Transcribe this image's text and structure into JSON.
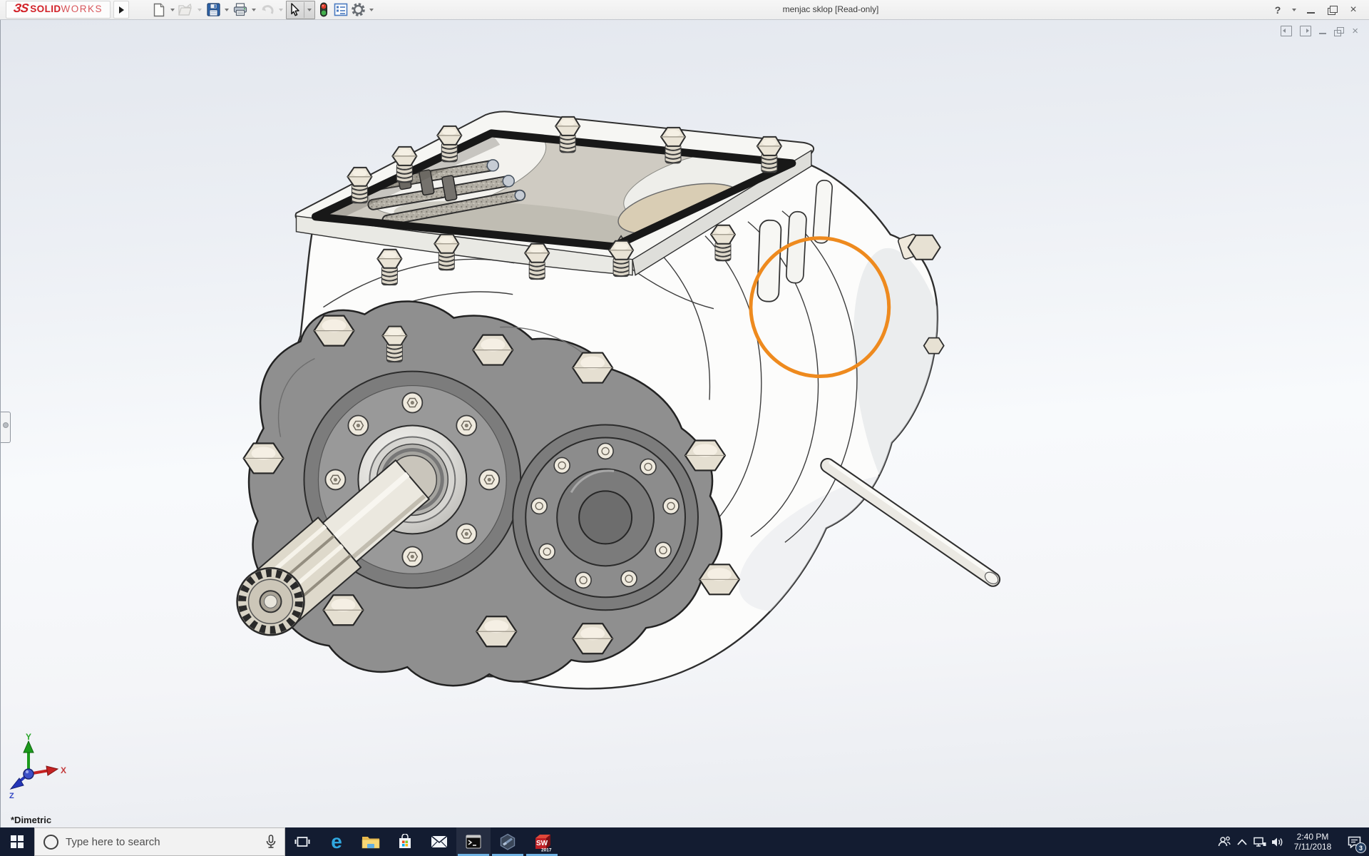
{
  "window": {
    "title": "menjac sklop [Read-only]",
    "help_label": "?"
  },
  "brand": {
    "logo_glyph": "ЗS",
    "logo_bold": "SOLID",
    "logo_light": "WORKS",
    "logo_color": "#d22128"
  },
  "toolbar": {
    "buttons": [
      {
        "name": "new-document",
        "enabled": true,
        "dropdown": true,
        "selected": false
      },
      {
        "name": "open-document",
        "enabled": false,
        "dropdown": true,
        "selected": false
      },
      {
        "name": "save",
        "enabled": true,
        "dropdown": true,
        "selected": false
      },
      {
        "name": "print",
        "enabled": true,
        "dropdown": true,
        "selected": false
      },
      {
        "name": "undo",
        "enabled": false,
        "dropdown": true,
        "selected": false
      },
      {
        "name": "select",
        "enabled": true,
        "dropdown": true,
        "selected": true
      },
      {
        "name": "rebuild-traffic-light",
        "enabled": true,
        "dropdown": false,
        "selected": false
      },
      {
        "name": "file-properties",
        "enabled": true,
        "dropdown": false,
        "selected": false
      },
      {
        "name": "options-gear",
        "enabled": true,
        "dropdown": true,
        "selected": false
      }
    ]
  },
  "document_controls": [
    "dock-pane-left",
    "dock-pane-right",
    "minimize-document",
    "restore-document",
    "close-document"
  ],
  "viewport": {
    "view_orientation_label": "*Dimetric",
    "triad": {
      "x_label": "X",
      "y_label": "Y",
      "z_label": "Z"
    },
    "annotation": {
      "type": "circle",
      "color": "#ee8a1e"
    },
    "content_description": "3D CAD model of a gearbox assembly: white cast housing, dark gray front flange with hex bolts, splined input shaft, bolted round side cover, open top with black gasket, shift rails and spring-loaded studs, thin output rod"
  },
  "taskbar": {
    "search": {
      "placeholder": "Type here to search"
    },
    "apps": [
      {
        "name": "task-view",
        "running": false
      },
      {
        "name": "microsoft-edge",
        "glyph": "e",
        "running": false
      },
      {
        "name": "file-explorer",
        "running": false
      },
      {
        "name": "microsoft-store",
        "running": false
      },
      {
        "name": "mail",
        "running": false
      },
      {
        "name": "command-prompt",
        "running": true,
        "active": true
      },
      {
        "name": "edrawings-hexagon",
        "running": true
      },
      {
        "name": "solidworks-2017",
        "label": "SW",
        "year": "2017",
        "running": true
      }
    ],
    "tray": {
      "icons": [
        "people",
        "hidden-icons-chevron",
        "network",
        "volume"
      ],
      "time": "2:40 PM",
      "date": "7/11/2018",
      "action_center_badge": "3"
    }
  }
}
